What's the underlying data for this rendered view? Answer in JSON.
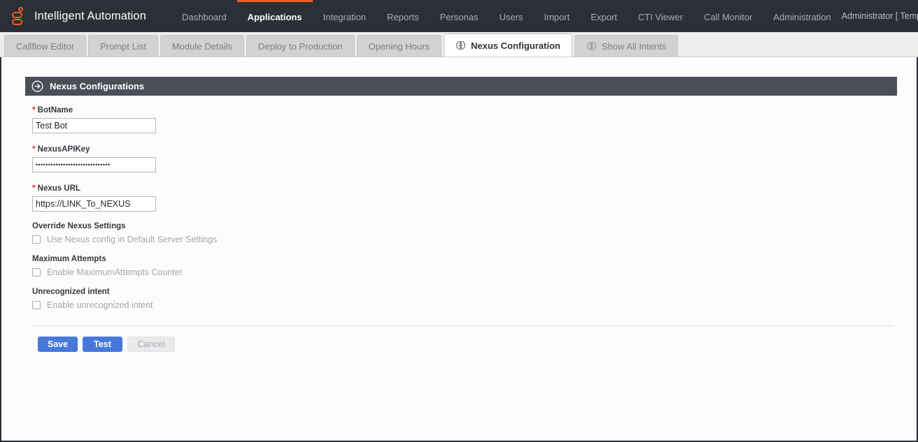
{
  "topbar": {
    "logo_icon": "logo-mark-icon",
    "brand": "Intelligent Automation",
    "nav": [
      {
        "label": "Dashboard",
        "active": false
      },
      {
        "label": "Applications",
        "active": true
      },
      {
        "label": "Integration",
        "active": false
      },
      {
        "label": "Reports",
        "active": false
      },
      {
        "label": "Personas",
        "active": false
      },
      {
        "label": "Users",
        "active": false
      },
      {
        "label": "Import",
        "active": false
      },
      {
        "label": "Export",
        "active": false
      },
      {
        "label": "CTI Viewer",
        "active": false
      },
      {
        "label": "Call Monitor",
        "active": false
      },
      {
        "label": "Administration",
        "active": false
      }
    ],
    "user_label": "Administrator [ Templates ]",
    "caret_icon": "chevron-down-icon",
    "help_icon": "question-mark-icon",
    "accent_color": "#f15a29",
    "background_color": "#2b2f36"
  },
  "tabs": [
    {
      "label": "Callflow Editor",
      "active": false,
      "icon": null
    },
    {
      "label": "Prompt List",
      "active": false,
      "icon": null
    },
    {
      "label": "Module Details",
      "active": false,
      "icon": null
    },
    {
      "label": "Deploy to Production",
      "active": false,
      "icon": null
    },
    {
      "label": "Opening Hours",
      "active": false,
      "icon": null
    },
    {
      "label": "Nexus Configuration",
      "active": true,
      "icon": "brain-icon"
    },
    {
      "label": "Show All Intents",
      "active": false,
      "icon": "brain-icon"
    }
  ],
  "panel": {
    "icon": "arrow-right-circle-icon",
    "title": "Nexus Configurations",
    "header_color": "#4a4f57"
  },
  "form": {
    "required_marker": "*",
    "fields": [
      {
        "label": "BotName",
        "required": true,
        "type": "text",
        "value": "Test Bot",
        "placeholder": ""
      },
      {
        "label": "NexusAPIKey",
        "required": true,
        "type": "password",
        "value": "••••••••••••••••••••••••••••••",
        "placeholder": ""
      },
      {
        "label": "Nexus URL",
        "required": true,
        "type": "text",
        "value": "https://LINK_To_NEXUS",
        "placeholder": ""
      }
    ],
    "checkbox_sections": [
      {
        "title": "Override Nexus Settings",
        "checkbox_label": "Use Nexus config in Default Server Settings",
        "checked": false
      },
      {
        "title": "Maximum Attempts",
        "checkbox_label": "Enable MaximumAttempts Counter",
        "checked": false
      },
      {
        "title": "Unrecognized intent",
        "checkbox_label": "Enable unrecognized intent",
        "checked": false
      }
    ]
  },
  "actions": {
    "save_label": "Save",
    "test_label": "Test",
    "cancel_label": "Cancel",
    "primary_color": "#4878dc"
  }
}
